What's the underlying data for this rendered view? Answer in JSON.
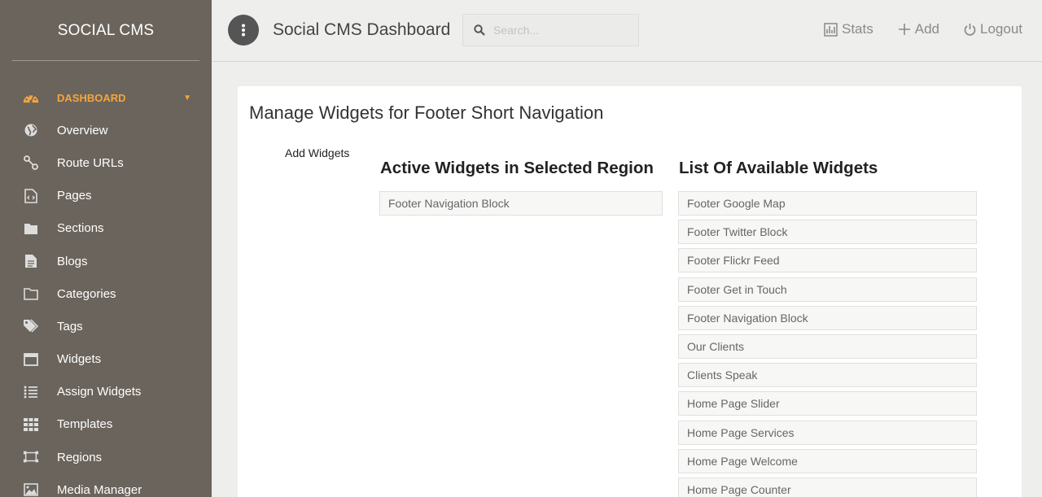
{
  "sidebar": {
    "brand": "SOCIAL CMS",
    "items": [
      {
        "label": "DASHBOARD",
        "icon": "dashboard-icon"
      },
      {
        "label": "Overview",
        "icon": "globe-icon"
      },
      {
        "label": "Route URLs",
        "icon": "route-icon"
      },
      {
        "label": "Pages",
        "icon": "file-code-icon"
      },
      {
        "label": "Sections",
        "icon": "folder-icon"
      },
      {
        "label": "Blogs",
        "icon": "file-text-icon"
      },
      {
        "label": "Categories",
        "icon": "folder-open-icon"
      },
      {
        "label": "Tags",
        "icon": "tags-icon"
      },
      {
        "label": "Widgets",
        "icon": "window-icon"
      },
      {
        "label": "Assign Widgets",
        "icon": "list-icon"
      },
      {
        "label": "Templates",
        "icon": "grid-icon"
      },
      {
        "label": "Regions",
        "icon": "regions-icon"
      },
      {
        "label": "Media Manager",
        "icon": "image-icon"
      }
    ]
  },
  "header": {
    "title": "Social CMS Dashboard",
    "search_placeholder": "Search...",
    "actions": {
      "stats": "Stats",
      "add": "Add",
      "logout": "Logout"
    }
  },
  "main": {
    "title": "Manage Widgets for Footer Short Navigation",
    "add_widgets_label": "Add Widgets",
    "active_heading": "Active Widgets in Selected Region",
    "available_heading": "List Of Available Widgets",
    "active_widgets": [
      "Footer Navigation Block"
    ],
    "available_widgets": [
      "Footer Google Map",
      "Footer Twitter Block",
      "Footer Flickr Feed",
      "Footer Get in Touch",
      "Footer Navigation Block",
      "Our Clients",
      "Clients Speak",
      "Home Page Slider",
      "Home Page Services",
      "Home Page Welcome",
      "Home Page Counter"
    ]
  },
  "colors": {
    "sidebar_bg": "#6b645c",
    "accent": "#f4a63b",
    "page_bg": "#eeeeec"
  }
}
